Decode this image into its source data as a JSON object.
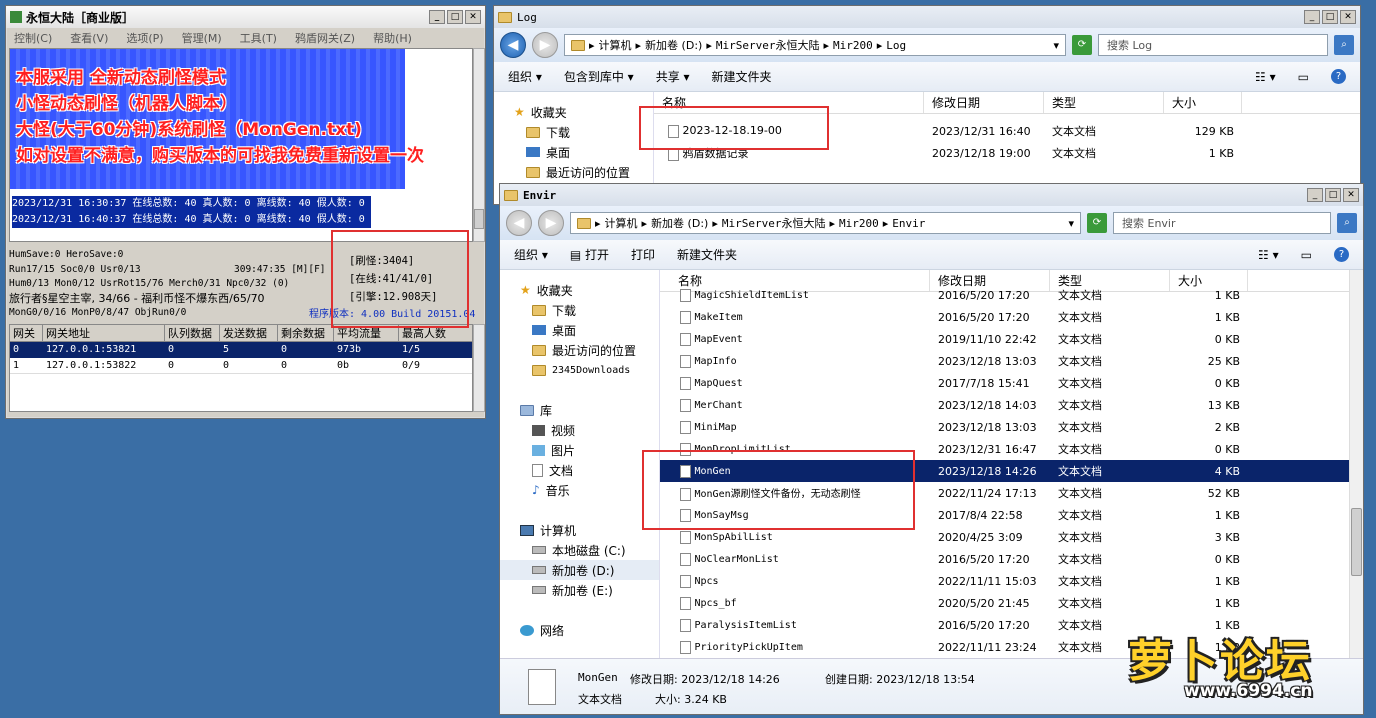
{
  "game_window": {
    "title": "永恒大陆［商业版］",
    "menu": [
      "控制(C)",
      "查看(V)",
      "选项(P)",
      "管理(M)",
      "工具(T)",
      "鸦盾网关(Z)",
      "帮助(H)"
    ],
    "banner": [
      "本服采用 全新动态刷怪模式",
      "小怪动态刷怪（机器人脚本）",
      "大怪(大于60分钟)系统刷怪（MonGen.txt)",
      "如对设置不满意，购买版本的可找我免费重新设置一次"
    ],
    "logs": [
      "2023/12/31 16:30:37 在线总数: 40 真人数: 0 离线数: 40 假人数: 0",
      "2023/12/31 16:40:37 在线总数: 40 真人数: 0 离线数: 40 假人数: 0"
    ],
    "status": [
      "HumSave:0 HeroSave:0",
      "Run17/15 Soc0/0 Usr0/13",
      "Hum0/13 Mon0/12 UsrRot15/76 Merch0/31 Npc0/32 (0)",
      "旅行者§星空主宰, 34/66 - 福利币怪不爆东西/65/70",
      "MonG0/0/16 MonP0/8/47 ObjRun0/0"
    ],
    "time_readout": "309:47:35 [M][F]",
    "counters": [
      "[刷怪:3404]",
      "[在线:41/41/0]",
      "[引擎:12.908天]"
    ],
    "version": "程序版本: 4.00 Build 20151.04",
    "grid_headers": [
      "网关",
      "网关地址",
      "队列数据",
      "发送数据",
      "剩余数据",
      "平均流量",
      "最高人数"
    ],
    "grid_rows": [
      [
        "0",
        "127.0.0.1:53821",
        "0",
        "5",
        "0",
        "973b",
        "1/5"
      ],
      [
        "1",
        "127.0.0.1:53822",
        "0",
        "0",
        "0",
        "0b",
        "0/9"
      ]
    ]
  },
  "log_window": {
    "title": "Log",
    "path": [
      "计算机",
      "新加卷 (D:)",
      "MirServer永恒大陆",
      "Mir200",
      "Log"
    ],
    "search": "搜索 Log",
    "commands": [
      "组织 ▾",
      "包含到库中 ▾",
      "共享 ▾",
      "新建文件夹"
    ],
    "nav": [
      "收藏夹",
      "下载",
      "桌面",
      "最近访问的位置"
    ],
    "headers": [
      "名称",
      "修改日期",
      "类型",
      "大小"
    ],
    "files": [
      [
        "2023-12-18.19-00",
        "2023/12/31 16:40",
        "文本文档",
        "129 KB"
      ],
      [
        "鸦盾数据记录",
        "2023/12/18 19:00",
        "文本文档",
        "1 KB"
      ]
    ]
  },
  "envir_window": {
    "title": "Envir",
    "path": [
      "计算机",
      "新加卷 (D:)",
      "MirServer永恒大陆",
      "Mir200",
      "Envir"
    ],
    "search": "搜索 Envir",
    "commands": [
      "组织 ▾",
      "打开",
      "打印",
      "新建文件夹"
    ],
    "nav": [
      "收藏夹",
      "下载",
      "桌面",
      "最近访问的位置",
      "2345Downloads",
      "库",
      "视频",
      "图片",
      "文档",
      "音乐",
      "计算机",
      "本地磁盘 (C:)",
      "新加卷 (D:)",
      "新加卷 (E:)",
      "网络"
    ],
    "headers": [
      "名称",
      "修改日期",
      "类型",
      "大小"
    ],
    "files": [
      [
        "MagicShieldItemList",
        "2016/5/20 17:20",
        "文本文档",
        "1 KB"
      ],
      [
        "MakeItem",
        "2016/5/20 17:20",
        "文本文档",
        "1 KB"
      ],
      [
        "MapEvent",
        "2019/11/10 22:42",
        "文本文档",
        "0 KB"
      ],
      [
        "MapInfo",
        "2023/12/18 13:03",
        "文本文档",
        "25 KB"
      ],
      [
        "MapQuest",
        "2017/7/18 15:41",
        "文本文档",
        "0 KB"
      ],
      [
        "MerChant",
        "2023/12/18 14:03",
        "文本文档",
        "13 KB"
      ],
      [
        "MiniMap",
        "2023/12/18 13:03",
        "文本文档",
        "2 KB"
      ],
      [
        "MonDropLimitList",
        "2023/12/31 16:47",
        "文本文档",
        "0 KB"
      ],
      [
        "MonGen",
        "2023/12/18 14:26",
        "文本文档",
        "4 KB"
      ],
      [
        "MonGen源刷怪文件备份，无动态刷怪",
        "2022/11/24 17:13",
        "文本文档",
        "52 KB"
      ],
      [
        "MonSayMsg",
        "2017/8/4 22:58",
        "文本文档",
        "1 KB"
      ],
      [
        "MonSpAbilList",
        "2020/4/25 3:09",
        "文本文档",
        "3 KB"
      ],
      [
        "NoClearMonList",
        "2016/5/20 17:20",
        "文本文档",
        "0 KB"
      ],
      [
        "Npcs",
        "2022/11/11 15:03",
        "文本文档",
        "1 KB"
      ],
      [
        "Npcs_bf",
        "2020/5/20 21:45",
        "文本文档",
        "1 KB"
      ],
      [
        "ParalysisItemList",
        "2016/5/20 17:20",
        "文本文档",
        "1 KB"
      ],
      [
        "PriorityPickUpItem",
        "2022/11/11 23:24",
        "文本文档",
        "1 KB"
      ]
    ],
    "details": {
      "name": "MonGen",
      "modified": "修改日期: 2023/12/18 14:26",
      "created": "创建日期: 2023/12/18 13:54",
      "type": "文本文档",
      "size": "大小: 3.24 KB"
    }
  },
  "watermark": {
    "logo": "萝卜论坛",
    "url": "www.6994.cn"
  }
}
